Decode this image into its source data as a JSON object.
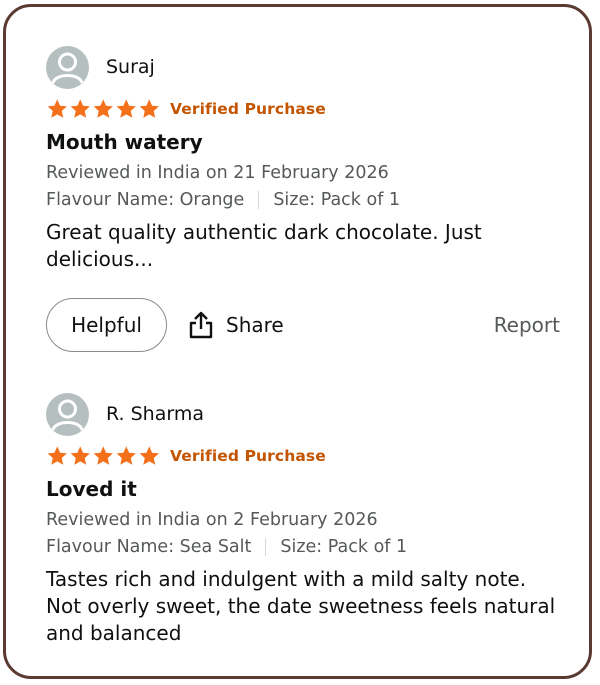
{
  "colors": {
    "frame_border": "#5a3a31",
    "star": "#f4701b",
    "verified": "#c45500",
    "meta_text": "#565959",
    "avatar_bg": "#b6bfc0"
  },
  "reviews": [
    {
      "reviewer": "Suraj",
      "stars": 5,
      "verified": "Verified Purchase",
      "title": "Mouth watery",
      "date": "Reviewed in India on 21 February 2026",
      "flavour": "Flavour Name: Orange",
      "size": "Size: Pack of 1",
      "body": "Great quality authentic dark chocolate. Just delicious...",
      "actions": {
        "helpful": "Helpful",
        "share": "Share",
        "report": "Report"
      }
    },
    {
      "reviewer": "R. Sharma",
      "stars": 5,
      "verified": "Verified Purchase",
      "title": "Loved it",
      "date": "Reviewed in India on 2 February 2026",
      "flavour": "Flavour Name: Sea Salt",
      "size": "Size: Pack of 1",
      "body": "Tastes rich and indulgent with a mild salty note. Not overly sweet, the date sweetness feels natural and balanced"
    }
  ]
}
